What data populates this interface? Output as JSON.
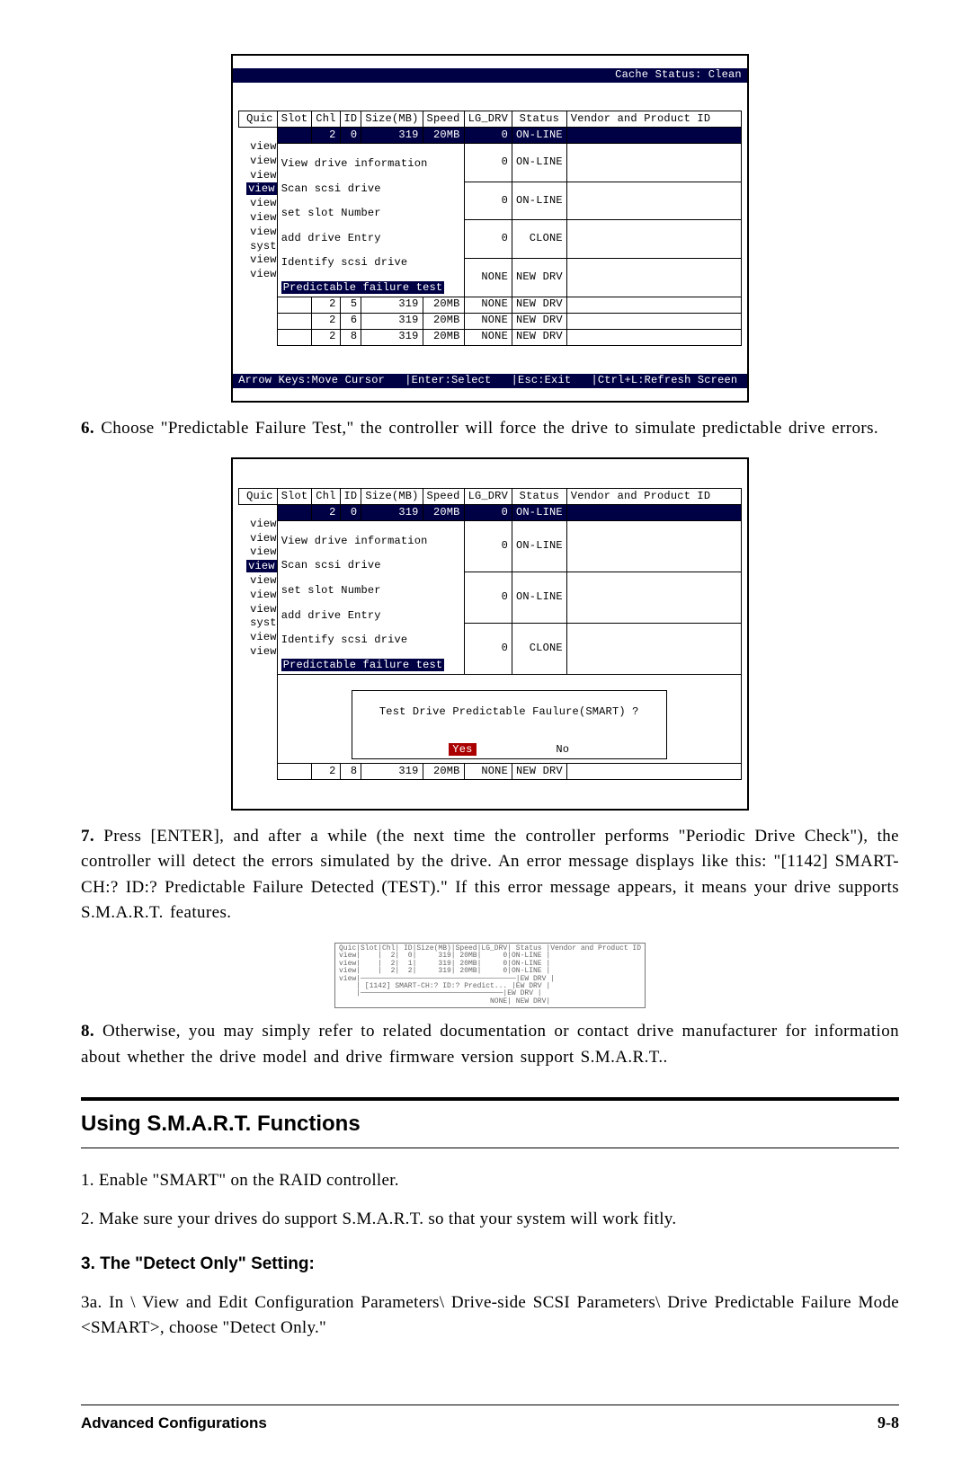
{
  "screenshot1": {
    "cache_status": "Cache Status: Clean",
    "headers": [
      "Quic",
      "Slot",
      "Chl",
      "ID",
      "Size(MB)",
      "Speed",
      "LG_DRV",
      "Status",
      "Vendor and Product ID"
    ],
    "row_top": [
      "",
      "",
      "2",
      "0",
      "319",
      "20MB",
      "0",
      "ON-LINE",
      ""
    ],
    "side_labels": [
      "view",
      "view",
      "view",
      "view",
      "view",
      "view",
      "view",
      "syst",
      "view",
      "view"
    ],
    "menu": [
      "View drive information",
      "Scan scsi drive",
      "set slot Number",
      "add drive Entry",
      "Identify scsi drive",
      "Predictable failure test"
    ],
    "rows_right": [
      {
        "lg": "0",
        "status": "ON-LINE"
      },
      {
        "lg": "0",
        "status": "ON-LINE"
      },
      {
        "lg": "0",
        "status": "CLONE"
      },
      {
        "lg": "NONE",
        "status": "NEW DRV"
      }
    ],
    "rows_bottom": [
      {
        "slot": "",
        "chl": "2",
        "id": "5",
        "size": "319",
        "speed": "20MB",
        "lg": "NONE",
        "status": "NEW DRV",
        "vp": ""
      },
      {
        "slot": "",
        "chl": "2",
        "id": "6",
        "size": "319",
        "speed": "20MB",
        "lg": "NONE",
        "status": "NEW DRV",
        "vp": ""
      },
      {
        "slot": "",
        "chl": "2",
        "id": "8",
        "size": "319",
        "speed": "20MB",
        "lg": "NONE",
        "status": "NEW DRV",
        "vp": ""
      }
    ],
    "footer": "Arrow Keys:Move Cursor   |Enter:Select   |Esc:Exit   |Ctrl+L:Refresh Screen"
  },
  "step6": {
    "num": "6.",
    "text": "  Choose \"Predictable Failure Test,\" the controller will force the drive to simulate predictable drive errors."
  },
  "screenshot2": {
    "headers": [
      "Quic",
      "Slot",
      "Chl",
      "ID",
      "Size(MB)",
      "Speed",
      "LG_DRV",
      "Status",
      "Vendor and Product ID"
    ],
    "row_top": [
      "",
      "",
      "2",
      "0",
      "319",
      "20MB",
      "0",
      "ON-LINE",
      ""
    ],
    "side_labels": [
      "view",
      "view",
      "view",
      "view",
      "view",
      "view",
      "view",
      "syst",
      "view",
      "view"
    ],
    "menu": [
      "View drive information",
      "Scan scsi drive",
      "set slot Number",
      "add drive Entry",
      "Identify scsi drive",
      "Predictable failure test"
    ],
    "rows_right": [
      {
        "lg": "0",
        "status": "ON-LINE"
      },
      {
        "lg": "0",
        "status": "ON-LINE"
      },
      {
        "lg": "0",
        "status": "CLONE"
      }
    ],
    "prompt": "Test Drive Predictable Faulure(SMART) ?",
    "yes": "Yes",
    "no": "No",
    "row_final": {
      "slot": "",
      "chl": "2",
      "id": "8",
      "size": "319",
      "speed": "20MB",
      "lg": "NONE",
      "status": "NEW DRV",
      "vp": ""
    }
  },
  "step7": {
    "num": "7.",
    "text": "  Press [ENTER], and after a while (the next time the controller performs \"Periodic Drive Check\"), the controller will detect the errors simulated by the drive.  An error message displays like this: \"[1142] SMART-CH:? ID:?  Predictable Failure Detected (TEST).\"  If this error message appears, it means your drive supports S.M.A.R.T. features."
  },
  "step8": {
    "num": "8.",
    "text": "  Otherwise, you may simply refer to related documentation or contact drive manufacturer for information about whether the drive model and drive firmware version support S.M.A.R.T.."
  },
  "section_heading": "Using S.M.A.R.T. Functions",
  "list1": "1.   Enable \"SMART\" on the RAID controller.",
  "list2": "2.  Make sure your drives do support S.M.A.R.T. so that your system will work fitly.",
  "subhead3": "3.  The \"Detect Only\" Setting:",
  "list3a": "3a.  In \\ View and Edit Configuration Parameters\\ Drive-side SCSI Parameters\\ Drive Predictable Failure Mode <SMART>, choose \"Detect Only.\"",
  "footer_left": "Advanced Configurations",
  "footer_right": "9-8"
}
